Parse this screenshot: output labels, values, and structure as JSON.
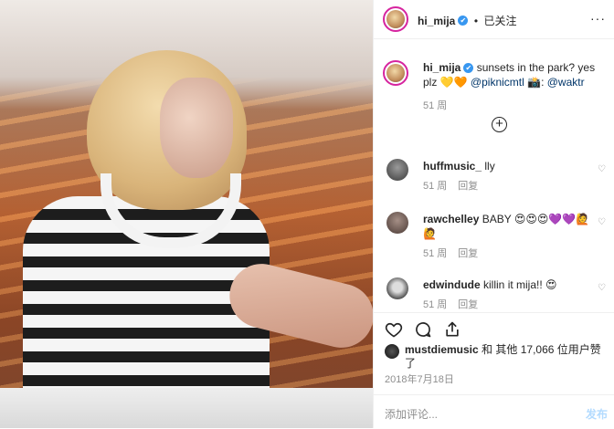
{
  "header": {
    "username": "hi_mija",
    "verified_mark": "✔",
    "separator": "•",
    "follow_status": "已关注",
    "more_label": "···"
  },
  "caption": {
    "username": "hi_mija",
    "text": "sunsets in the park? yes plz",
    "emoji": "💛🧡",
    "mention1": "@piknicmtl",
    "camera": "📸:",
    "mention2": "@waktr",
    "time": "51 周"
  },
  "load_more_label": "+",
  "comments": [
    {
      "username": "huffmusic_",
      "text": "lly",
      "time": "51 周",
      "reply": "回复"
    },
    {
      "username": "rawchelley",
      "text": "BABY 😍😍😍💜💜🙋🙋",
      "time": "51 周",
      "reply": "回复"
    },
    {
      "username": "edwindude",
      "text": "killin it mija!! 😍",
      "time": "51 周",
      "reply": "回复"
    }
  ],
  "likes": {
    "user": "mustdiemusic",
    "text": "和 其他 17,066 位用户赞了"
  },
  "date": "2018年7月18日",
  "add_comment": {
    "placeholder": "添加评论...",
    "post_label": "发布"
  },
  "icons": [
    "heart-icon",
    "comment-icon",
    "share-icon",
    "more-icon",
    "verified-icon",
    "plus-circle-icon"
  ],
  "colors": {
    "verified": "#3897f0",
    "mention": "#003569",
    "muted": "#8e8e8e",
    "post_disabled": "#b3dbff",
    "story_ring": "#d6249f"
  }
}
